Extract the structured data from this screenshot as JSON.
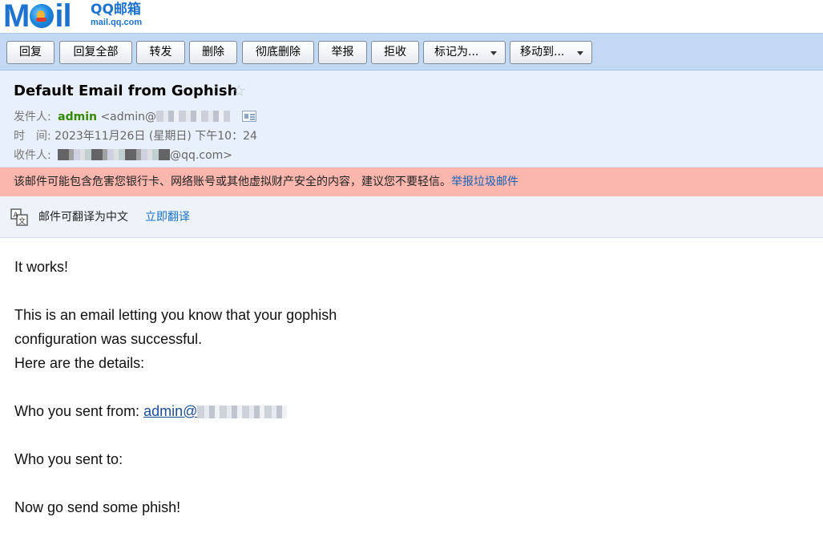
{
  "logo": {
    "brand": "Mail",
    "cn_name": "QQ邮箱",
    "url": "mail.qq.com"
  },
  "toolbar": {
    "buttons": [
      {
        "label": "回复"
      },
      {
        "label": "回复全部"
      },
      {
        "label": "转发"
      },
      {
        "label": "删除"
      },
      {
        "label": "彻底删除"
      },
      {
        "label": "举报"
      },
      {
        "label": "拒收"
      },
      {
        "label": "标记为..."
      },
      {
        "label": "移动到..."
      }
    ]
  },
  "header": {
    "subject": "Default Email from Gophish",
    "star_glyph": "☆",
    "from_label": "发件人:",
    "from_name": "admin",
    "from_addr_prefix": "<admin@",
    "time_label": "时　间:",
    "time_value": "2023年11月26日 (星期日) 下午10：24",
    "to_label": "收件人:",
    "to_addr_suffix": "@qq.com>"
  },
  "warning": {
    "text": "该邮件可能包含危害您银行卡、网络账号或其他虚拟财产安全的内容，建议您不要轻信。",
    "link": "举报垃圾邮件"
  },
  "translate": {
    "icon": "translate-icon",
    "label": "邮件可翻译为中文",
    "link": "立即翻译"
  },
  "body": {
    "line1": "It works!",
    "line2": "This is an email letting you know that your gophish",
    "line3": "configuration was successful.",
    "line4": "Here are the details:",
    "from_prefix": "Who you sent from: ",
    "from_link": "admin@",
    "to_line": "Who you sent to:",
    "closing": "Now go send some phish!"
  },
  "colors": {
    "toolbar_bg": "#c3d9f3",
    "header_bg": "#e8f0fb",
    "warning_bg": "#fbb7ad",
    "sender_green": "#338800",
    "link_blue": "#1a73c8"
  }
}
